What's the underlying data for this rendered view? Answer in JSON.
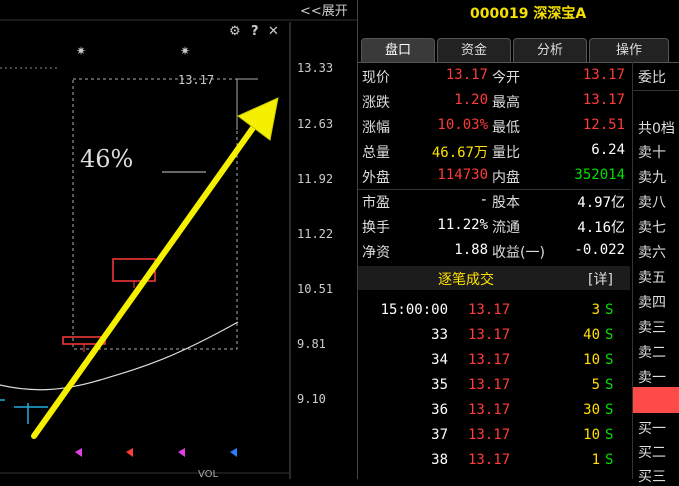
{
  "chart": {
    "expand_label": "<<展开",
    "controls": {
      "settings": "⚙",
      "help": "?",
      "close": "✕"
    },
    "price_labels": [
      "13.33",
      "12.63",
      "11.92",
      "11.22",
      "10.51",
      "9.81",
      "9.10"
    ],
    "box_top_label": "13.17",
    "percent_label": "46%",
    "bottom_label": "VOL"
  },
  "header": {
    "title": "000019 深深宝A"
  },
  "tabs": [
    "盘口",
    "资金",
    "分析",
    "操作"
  ],
  "quote": {
    "rows": [
      {
        "l1": "现价",
        "v1": "13.17",
        "c1": "red",
        "l2": "今开",
        "v2": "13.17",
        "c2": "red"
      },
      {
        "l1": "涨跌",
        "v1": "1.20",
        "c1": "red",
        "l2": "最高",
        "v2": "13.17",
        "c2": "red"
      },
      {
        "l1": "涨幅",
        "v1": "10.03%",
        "c1": "red",
        "l2": "最低",
        "v2": "12.51",
        "c2": "red"
      },
      {
        "l1": "总量",
        "v1": "46.67万",
        "c1": "yellow",
        "l2": "量比",
        "v2": "6.24",
        "c2": "white"
      },
      {
        "l1": "外盘",
        "v1": "114730",
        "c1": "red",
        "l2": "内盘",
        "v2": "352014",
        "c2": "green"
      },
      {
        "l1": "市盈",
        "v1": "-",
        "c1": "white",
        "l2": "股本",
        "v2": "4.97亿",
        "c2": "white"
      },
      {
        "l1": "换手",
        "v1": "11.22%",
        "c1": "white",
        "l2": "流通",
        "v2": "4.16亿",
        "c2": "white"
      },
      {
        "l1": "净资",
        "v1": "1.88",
        "c1": "white",
        "l2": "收益(一)",
        "v2": "-0.022",
        "c2": "white"
      }
    ]
  },
  "trades": {
    "title": "逐笔成交",
    "detail": "[详]",
    "rows": [
      {
        "time": "15:00:00",
        "price": "13.17",
        "vol": "3",
        "side": "S"
      },
      {
        "time": "33",
        "price": "13.17",
        "vol": "40",
        "side": "S"
      },
      {
        "time": "34",
        "price": "13.17",
        "vol": "10",
        "side": "S"
      },
      {
        "time": "35",
        "price": "13.17",
        "vol": "5",
        "side": "S"
      },
      {
        "time": "36",
        "price": "13.17",
        "vol": "30",
        "side": "S"
      },
      {
        "time": "37",
        "price": "13.17",
        "vol": "10",
        "side": "S"
      },
      {
        "time": "38",
        "price": "13.17",
        "vol": "1",
        "side": "S"
      }
    ]
  },
  "orderbook": {
    "weibi": "委比",
    "total": "共0档",
    "sells": [
      "卖十",
      "卖九",
      "卖八",
      "卖七",
      "卖六",
      "卖五",
      "卖四",
      "卖三",
      "卖二",
      "卖一"
    ],
    "buys": [
      "买一",
      "买二",
      "买三"
    ]
  },
  "colors": {
    "up": "#ff3b3b",
    "down": "#00e000",
    "accent": "#ffe000"
  }
}
